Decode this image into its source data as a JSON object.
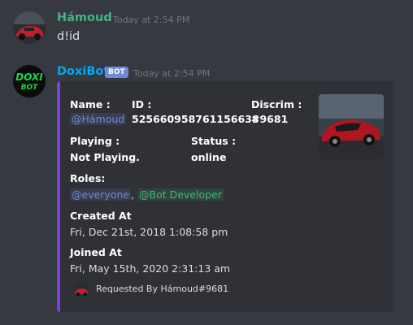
{
  "messages": [
    {
      "author": "Hámoud",
      "author_color": "#43b581",
      "timestamp": "Today at 2:54 PM",
      "content": "d!id",
      "avatar_icon": "red-car-avatar-icon"
    },
    {
      "author": "DoxiBot",
      "author_color": "#00a8fc",
      "bot_tag": "BOT",
      "timestamp": "Today at 2:54 PM",
      "avatar_icon": "doxi-bot-logo-icon",
      "avatar_text": [
        "DOXI",
        "BOT"
      ]
    }
  ],
  "embed": {
    "accent_color": "#7b3fe4",
    "name_label": "Name :",
    "name_value": "@Hámoud",
    "id_label": "ID :",
    "id_value": "525660958761156638",
    "discrim_label": "Discrim :",
    "discrim_value": "#9681",
    "playing_label": "Playing :",
    "playing_value": "Not Playing.",
    "status_label": "Status :",
    "status_value": "online",
    "roles_label": "Roles:",
    "roles": [
      "@everyone",
      "@Bot Developer"
    ],
    "roles_separator": ",",
    "created_label": "Created At",
    "created_value": "Fri, Dec 21st, 2018 1:08:58 pm",
    "joined_label": "Joined At",
    "joined_value": "Fri, May 15th, 2020 2:31:13 am",
    "footer_text": "Requested By Hámoud#9681",
    "thumbnail_icon": "red-mustang-car-thumbnail"
  }
}
